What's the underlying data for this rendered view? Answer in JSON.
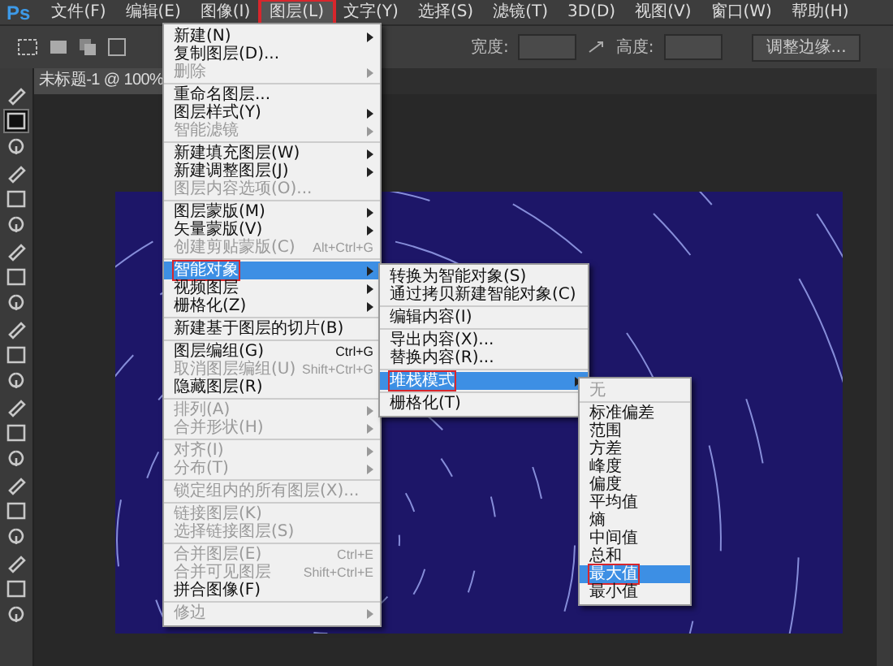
{
  "app_logo": "Ps",
  "menubar": [
    {
      "label": "文件(F)",
      "selected": false
    },
    {
      "label": "编辑(E)",
      "selected": false
    },
    {
      "label": "图像(I)",
      "selected": false
    },
    {
      "label": "图层(L)",
      "selected": true
    },
    {
      "label": "文字(Y)",
      "selected": false
    },
    {
      "label": "选择(S)",
      "selected": false
    },
    {
      "label": "滤镜(T)",
      "selected": false
    },
    {
      "label": "3D(D)",
      "selected": false
    },
    {
      "label": "视图(V)",
      "selected": false
    },
    {
      "label": "窗口(W)",
      "selected": false
    },
    {
      "label": "帮助(H)",
      "selected": false
    }
  ],
  "options_bar": {
    "width_label": "宽度:",
    "height_label": "高度:",
    "refine_button": "调整边缘..."
  },
  "document_tab": "未标题-1 @ 100%",
  "tools": [
    {
      "selected": false
    },
    {
      "selected": true
    },
    {
      "selected": false
    },
    {
      "selected": false
    },
    {
      "selected": false
    },
    {
      "selected": false
    },
    {
      "selected": false
    },
    {
      "selected": false
    },
    {
      "selected": false
    },
    {
      "selected": false
    },
    {
      "selected": false
    },
    {
      "selected": false
    },
    {
      "selected": false
    },
    {
      "selected": false
    },
    {
      "selected": false
    },
    {
      "selected": false
    },
    {
      "selected": false
    },
    {
      "selected": false
    },
    {
      "selected": false
    },
    {
      "selected": false
    },
    {
      "selected": false
    }
  ],
  "layer_menu": {
    "groups": [
      [
        {
          "label": "新建(N)",
          "disabled": false,
          "submenu": true,
          "selected": false,
          "marked": false
        },
        {
          "label": "复制图层(D)...",
          "disabled": false,
          "submenu": false,
          "selected": false,
          "marked": false
        },
        {
          "label": "删除",
          "disabled": true,
          "submenu": true,
          "selected": false,
          "marked": false
        }
      ],
      [
        {
          "label": "重命名图层...",
          "disabled": false,
          "submenu": false,
          "selected": false,
          "marked": false
        },
        {
          "label": "图层样式(Y)",
          "disabled": false,
          "submenu": true,
          "selected": false,
          "marked": false
        },
        {
          "label": "智能滤镜",
          "disabled": true,
          "submenu": true,
          "selected": false,
          "marked": false
        }
      ],
      [
        {
          "label": "新建填充图层(W)",
          "disabled": false,
          "submenu": true,
          "selected": false,
          "marked": false
        },
        {
          "label": "新建调整图层(J)",
          "disabled": false,
          "submenu": true,
          "selected": false,
          "marked": false
        },
        {
          "label": "图层内容选项(O)...",
          "disabled": true,
          "submenu": false,
          "selected": false,
          "marked": false
        }
      ],
      [
        {
          "label": "图层蒙版(M)",
          "disabled": false,
          "submenu": true,
          "selected": false,
          "marked": false
        },
        {
          "label": "矢量蒙版(V)",
          "disabled": false,
          "submenu": true,
          "selected": false,
          "marked": false
        },
        {
          "label": "创建剪贴蒙版(C)",
          "shortcut": "Alt+Ctrl+G",
          "disabled": true,
          "submenu": false,
          "selected": false,
          "marked": false
        }
      ],
      [
        {
          "label": "智能对象",
          "disabled": false,
          "submenu": true,
          "selected": true,
          "marked": true
        },
        {
          "label": "视频图层",
          "disabled": false,
          "submenu": true,
          "selected": false,
          "marked": false
        },
        {
          "label": "栅格化(Z)",
          "disabled": false,
          "submenu": true,
          "selected": false,
          "marked": false
        }
      ],
      [
        {
          "label": "新建基于图层的切片(B)",
          "disabled": false,
          "submenu": false,
          "selected": false,
          "marked": false
        }
      ],
      [
        {
          "label": "图层编组(G)",
          "shortcut": "Ctrl+G",
          "disabled": false,
          "submenu": false,
          "selected": false,
          "marked": false
        },
        {
          "label": "取消图层编组(U)",
          "shortcut": "Shift+Ctrl+G",
          "disabled": true,
          "submenu": false,
          "selected": false,
          "marked": false
        },
        {
          "label": "隐藏图层(R)",
          "disabled": false,
          "submenu": false,
          "selected": false,
          "marked": false
        }
      ],
      [
        {
          "label": "排列(A)",
          "disabled": true,
          "submenu": true,
          "selected": false,
          "marked": false
        },
        {
          "label": "合并形状(H)",
          "disabled": true,
          "submenu": true,
          "selected": false,
          "marked": false
        }
      ],
      [
        {
          "label": "对齐(I)",
          "disabled": true,
          "submenu": true,
          "selected": false,
          "marked": false
        },
        {
          "label": "分布(T)",
          "disabled": true,
          "submenu": true,
          "selected": false,
          "marked": false
        }
      ],
      [
        {
          "label": "锁定组内的所有图层(X)...",
          "disabled": true,
          "submenu": false,
          "selected": false,
          "marked": false
        }
      ],
      [
        {
          "label": "链接图层(K)",
          "disabled": true,
          "submenu": false,
          "selected": false,
          "marked": false
        },
        {
          "label": "选择链接图层(S)",
          "disabled": true,
          "submenu": false,
          "selected": false,
          "marked": false
        }
      ],
      [
        {
          "label": "合并图层(E)",
          "shortcut": "Ctrl+E",
          "disabled": true,
          "submenu": false,
          "selected": false,
          "marked": false
        },
        {
          "label": "合并可见图层",
          "shortcut": "Shift+Ctrl+E",
          "disabled": true,
          "submenu": false,
          "selected": false,
          "marked": false
        },
        {
          "label": "拼合图像(F)",
          "disabled": false,
          "submenu": false,
          "selected": false,
          "marked": false
        }
      ],
      [
        {
          "label": "修边",
          "disabled": true,
          "submenu": true,
          "selected": false,
          "marked": false
        }
      ]
    ]
  },
  "smart_object_menu": {
    "groups": [
      [
        {
          "label": "转换为智能对象(S)",
          "disabled": false,
          "submenu": false,
          "selected": false,
          "marked": false
        },
        {
          "label": "通过拷贝新建智能对象(C)",
          "disabled": false,
          "submenu": false,
          "selected": false,
          "marked": false
        }
      ],
      [
        {
          "label": "编辑内容(I)",
          "disabled": false,
          "submenu": false,
          "selected": false,
          "marked": false
        }
      ],
      [
        {
          "label": "导出内容(X)...",
          "disabled": false,
          "submenu": false,
          "selected": false,
          "marked": false
        },
        {
          "label": "替换内容(R)...",
          "disabled": false,
          "submenu": false,
          "selected": false,
          "marked": false
        }
      ],
      [
        {
          "label": "堆栈模式",
          "disabled": false,
          "submenu": true,
          "selected": true,
          "marked": true
        }
      ],
      [
        {
          "label": "栅格化(T)",
          "disabled": false,
          "submenu": false,
          "selected": false,
          "marked": false
        }
      ]
    ]
  },
  "stack_mode_menu": {
    "groups": [
      [
        {
          "label": "无",
          "disabled": true,
          "submenu": false,
          "selected": false,
          "marked": false
        }
      ],
      [
        {
          "label": "标准偏差",
          "disabled": false,
          "submenu": false,
          "selected": false,
          "marked": false
        },
        {
          "label": "范围",
          "disabled": false,
          "submenu": false,
          "selected": false,
          "marked": false
        },
        {
          "label": "方差",
          "disabled": false,
          "submenu": false,
          "selected": false,
          "marked": false
        },
        {
          "label": "峰度",
          "disabled": false,
          "submenu": false,
          "selected": false,
          "marked": false
        },
        {
          "label": "偏度",
          "disabled": false,
          "submenu": false,
          "selected": false,
          "marked": false
        },
        {
          "label": "平均值",
          "disabled": false,
          "submenu": false,
          "selected": false,
          "marked": false
        },
        {
          "label": "熵",
          "disabled": false,
          "submenu": false,
          "selected": false,
          "marked": false
        },
        {
          "label": "中间值",
          "disabled": false,
          "submenu": false,
          "selected": false,
          "marked": false
        },
        {
          "label": "总和",
          "disabled": false,
          "submenu": false,
          "selected": false,
          "marked": false
        },
        {
          "label": "最大值",
          "disabled": false,
          "submenu": false,
          "selected": true,
          "marked": true
        },
        {
          "label": "最小值",
          "disabled": false,
          "submenu": false,
          "selected": false,
          "marked": false
        }
      ]
    ]
  }
}
